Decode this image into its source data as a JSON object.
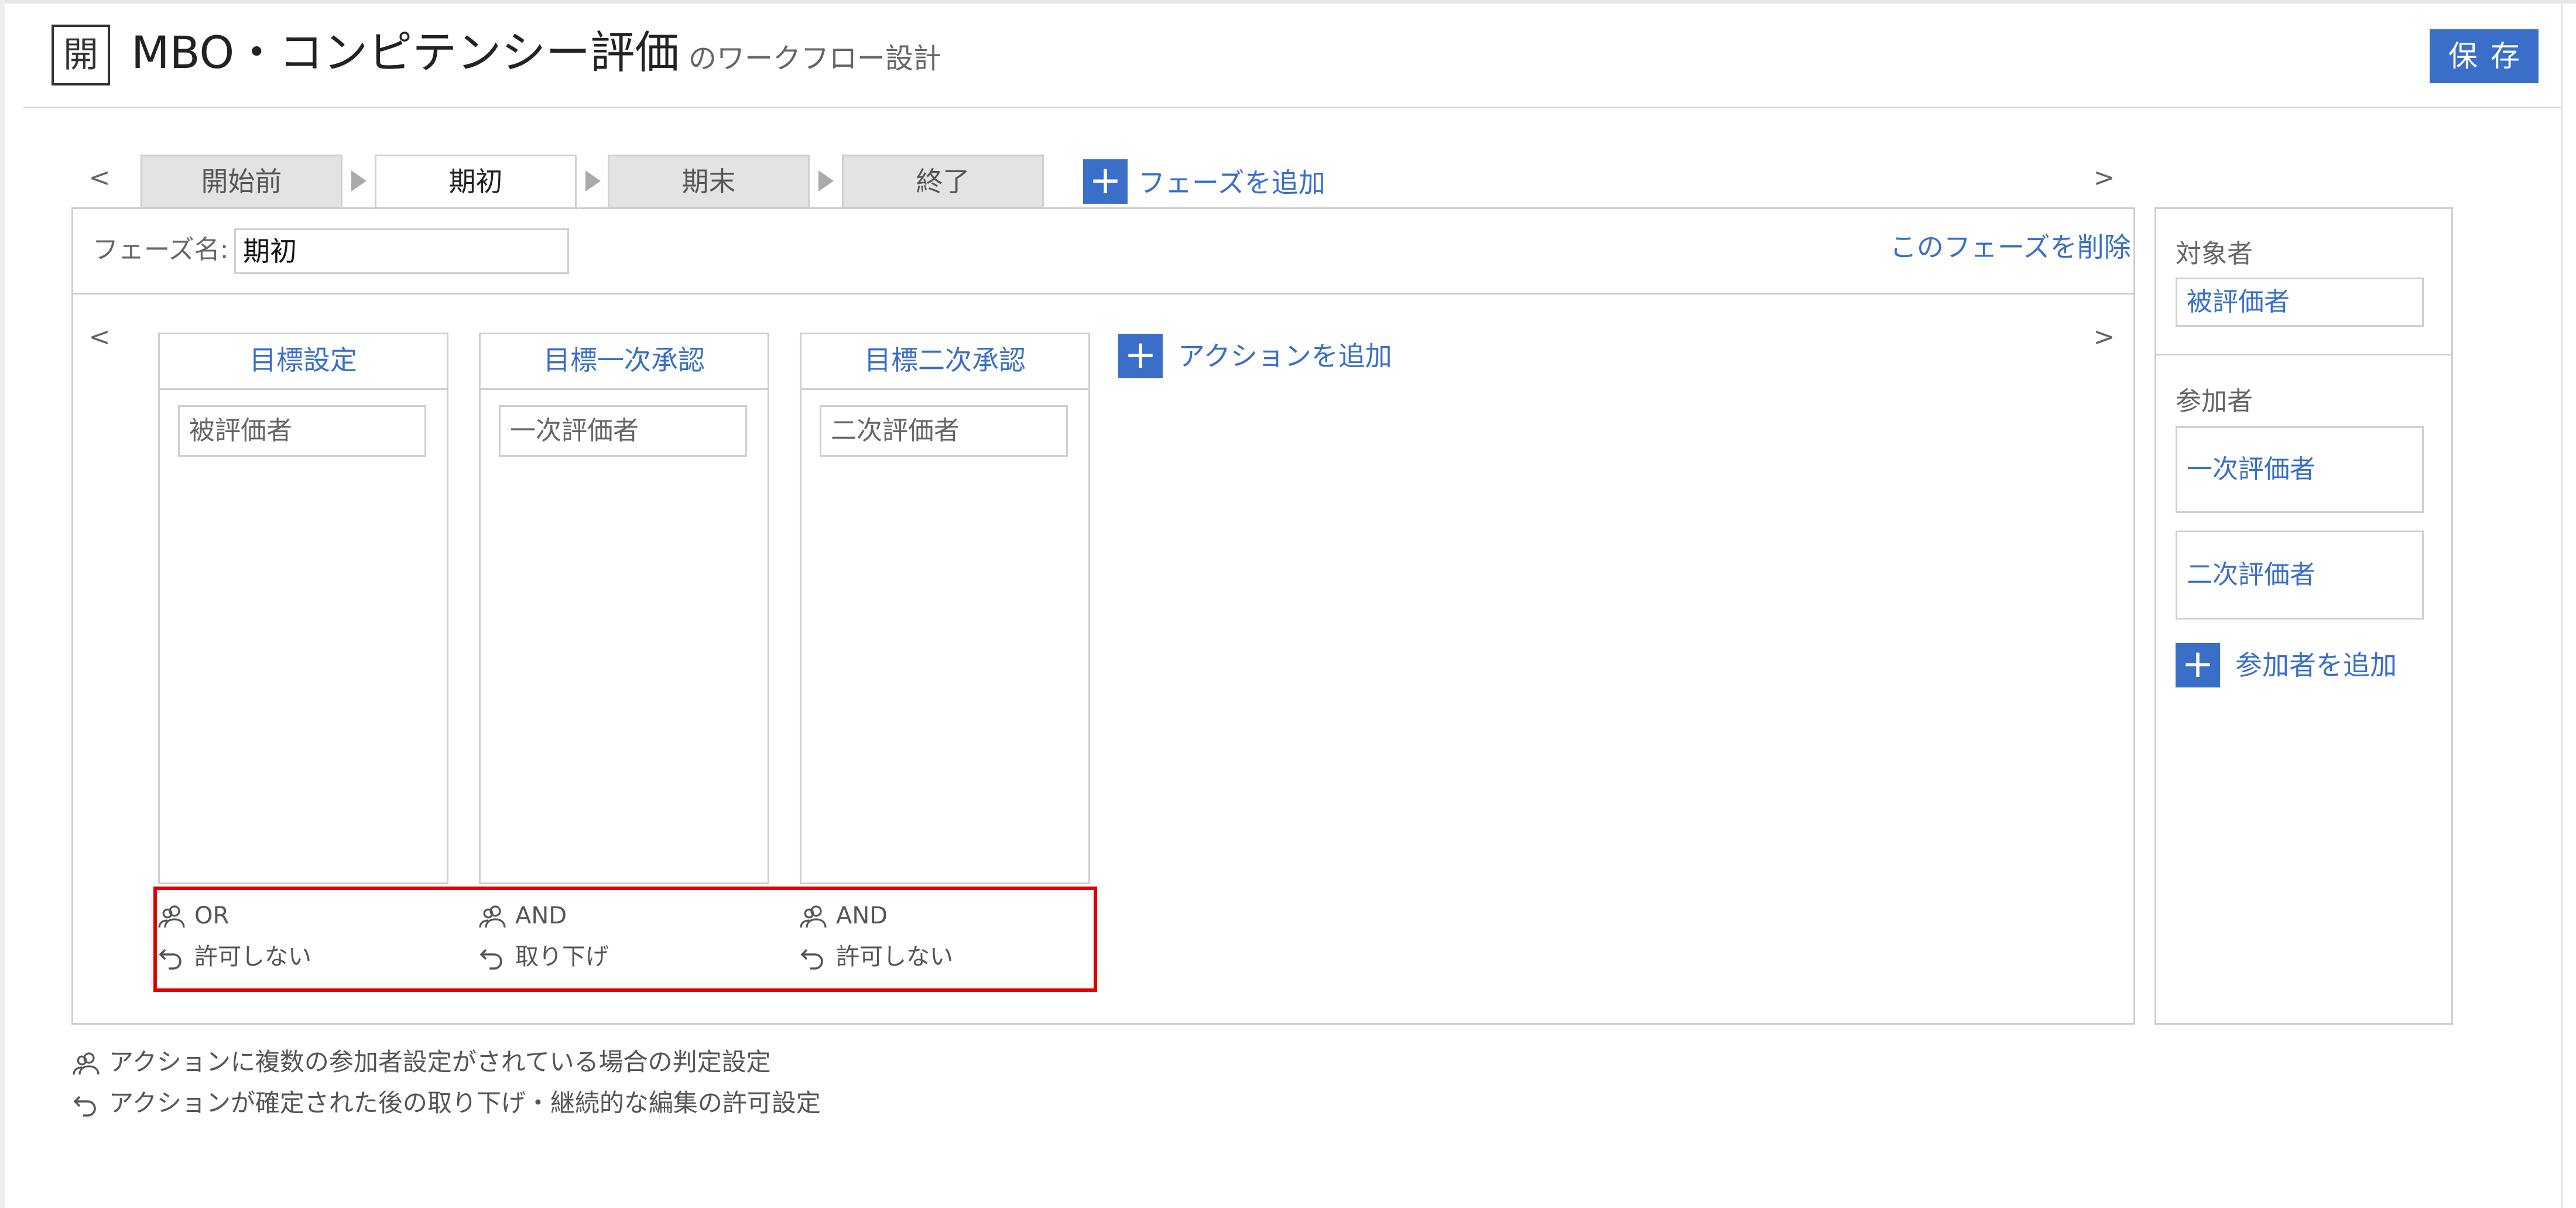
{
  "app": {
    "icon_glyph": "開",
    "title": "MBO・コンピテンシー評価",
    "subtitle": "のワークフロー設計",
    "save_label": "保存"
  },
  "phase_tabs": {
    "prev": "<",
    "next": ">",
    "tabs": [
      {
        "label": "開始前",
        "active": false
      },
      {
        "label": "期初",
        "active": true
      },
      {
        "label": "期末",
        "active": false
      },
      {
        "label": "終了",
        "active": false
      }
    ],
    "add_label": "フェーズを追加"
  },
  "phase": {
    "name_label": "フェーズ名:",
    "name_value": "期初",
    "delete_label": "このフェーズを削除"
  },
  "actions": {
    "prev": "<",
    "next": ">",
    "add_label": "アクションを追加",
    "columns": [
      {
        "title": "目標設定",
        "role": "被評価者",
        "judgement": "OR",
        "withdraw": "許可しない"
      },
      {
        "title": "目標一次承認",
        "role": "一次評価者",
        "judgement": "AND",
        "withdraw": "取り下げ"
      },
      {
        "title": "目標二次承認",
        "role": "二次評価者",
        "judgement": "AND",
        "withdraw": "許可しない"
      }
    ]
  },
  "sidebar": {
    "target_label": "対象者",
    "target_value": "被評価者",
    "participants_label": "参加者",
    "participants": [
      "一次評価者",
      "二次評価者"
    ],
    "add_label": "参加者を追加"
  },
  "legend": {
    "judgement_note": "アクションに複数の参加者設定がされている場合の判定設定",
    "withdraw_note": "アクションが確定された後の取り下げ・継続的な編集の許可設定"
  },
  "colors": {
    "accent": "#3a6fc9",
    "highlight": "#e00000",
    "border": "#cfcfcf"
  },
  "icons": {
    "users": "users-icon",
    "undo": "undo-icon",
    "plus": "plus-icon"
  }
}
